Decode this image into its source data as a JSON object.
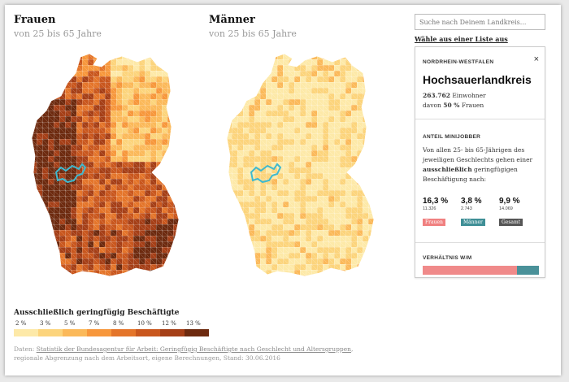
{
  "panels": {
    "women": {
      "title": "Frauen",
      "subtitle": "von 25 bis 65 Jahre"
    },
    "men": {
      "title": "Männer",
      "subtitle": "von 25 bis 65 Jahre"
    }
  },
  "legend": {
    "title": "Ausschließlich geringfügig Beschäftigte",
    "ticks": [
      "2 %",
      "3 %",
      "5 %",
      "7 %",
      "8 %",
      "10 %",
      "12 %",
      "13 %"
    ],
    "colors": [
      "#fde9a8",
      "#fcd47c",
      "#fbb95a",
      "#f7973c",
      "#e4752a",
      "#c9571e",
      "#a53f17",
      "#6d2a0f"
    ]
  },
  "source": {
    "prefix": "Daten: ",
    "link": "Statistik der Bundesagentur für Arbeit: Geringfügig Beschäftigte nach Geschlecht und Altersgruppen",
    "suffix": ", regionale Abgrenzung nach dem Arbeitsort, eigene Berechnungen, Stand: 30.06.2016"
  },
  "search": {
    "placeholder": "Suche nach Deinem Landkreis..."
  },
  "list_link": "Wähle aus einer Liste aus",
  "card": {
    "state": "NORDRHEIN-WESTFALEN",
    "close_glyph": "×",
    "name": "Hochsauerlandkreis",
    "population_value": "263.762",
    "population_label": " Einwohner",
    "women_prefix": "davon ",
    "women_value": "50 %",
    "women_label": " Frauen",
    "section_title": "ANTEIL MINIJOBBER",
    "text_1": "Von allen 25- bis 65-Jährigen des jeweiligen Geschlechts gehen einer ",
    "text_bold": "ausschließlich",
    "text_2": " geringfügigen Beschäftigung nach:",
    "stats": [
      {
        "value": "16,3 %",
        "count": "11.326",
        "label": "Frauen",
        "color": "#f08080"
      },
      {
        "value": "3,8 %",
        "count": "2.743",
        "label": "Männer",
        "color": "#3f8f96"
      },
      {
        "value": "9,9 %",
        "count": "14.069",
        "label": "Gesamt",
        "color": "#555555"
      }
    ],
    "ratio_title": "VERHÄLTNIS W/M",
    "ratio": {
      "women": 0.81,
      "men": 0.19,
      "women_color": "#f08a8a",
      "men_color": "#4a9199"
    }
  },
  "highlight_color": "#3fb9cf"
}
